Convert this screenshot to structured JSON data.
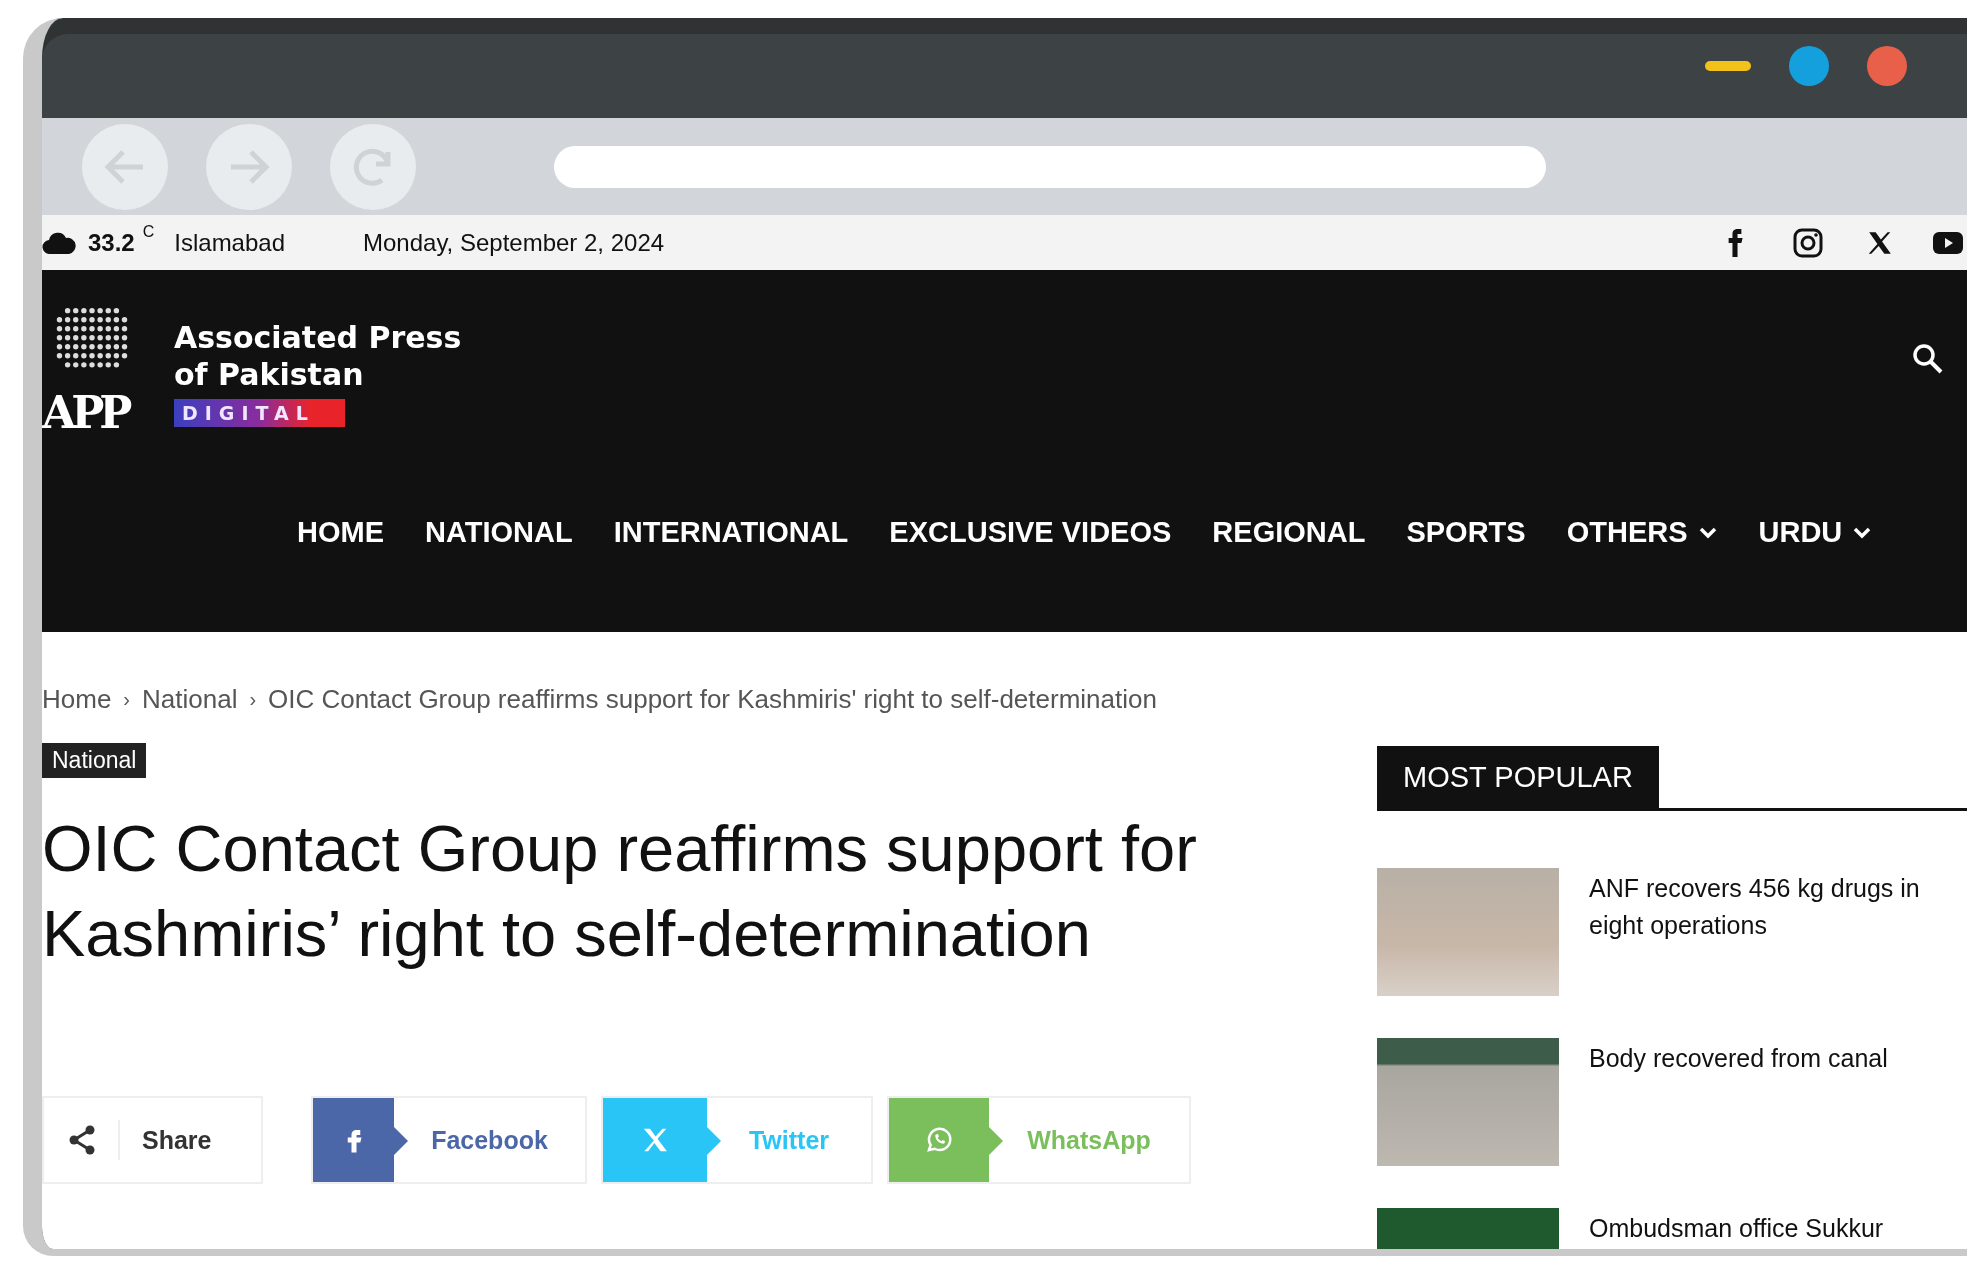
{
  "top_bar": {
    "temperature": "33.2",
    "unit": "C",
    "city": "Islamabad",
    "date": "Monday, September 2, 2024"
  },
  "logo": {
    "mark": "APP",
    "line_1": "Associated Press",
    "line_2": "of Pakistan",
    "badge": "DIGITAL"
  },
  "nav": [
    {
      "label": "HOME",
      "dropdown": false
    },
    {
      "label": "NATIONAL",
      "dropdown": false
    },
    {
      "label": "INTERNATIONAL",
      "dropdown": false
    },
    {
      "label": "EXCLUSIVE VIDEOS",
      "dropdown": false
    },
    {
      "label": "REGIONAL",
      "dropdown": false
    },
    {
      "label": "SPORTS",
      "dropdown": false
    },
    {
      "label": "OTHERS",
      "dropdown": true
    },
    {
      "label": "URDU",
      "dropdown": true
    }
  ],
  "breadcrumb_separator": "›",
  "breadcrumb": [
    "Home",
    "National",
    "OIC Contact Group reaffirms support for Kashmiris' right to self-determination"
  ],
  "category": "National",
  "headline": "OIC Contact Group reaffirms support for Kashmiris’ right to self-determination",
  "share": {
    "label": "Share",
    "buttons": [
      {
        "kind": "facebook",
        "label": "Facebook"
      },
      {
        "kind": "twitter",
        "label": "Twitter"
      },
      {
        "kind": "whatsapp",
        "label": "WhatsApp"
      }
    ]
  },
  "sidebar": {
    "title": "MOST POPULAR",
    "items": [
      {
        "title": "ANF recovers 456 kg drugs in eight operations"
      },
      {
        "title": "Body recovered from canal"
      },
      {
        "title": "Ombudsman office Sukkur"
      }
    ]
  }
}
